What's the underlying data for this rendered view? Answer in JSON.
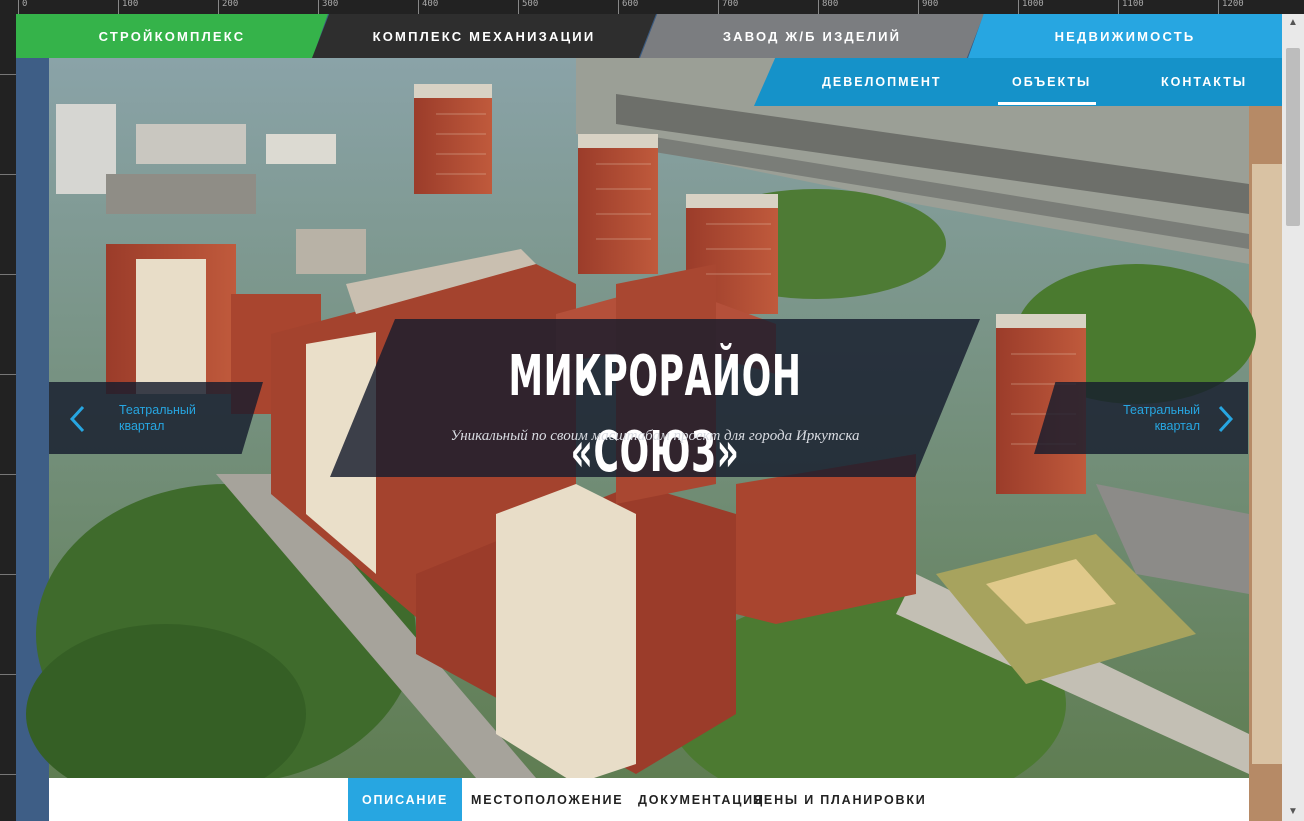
{
  "top_nav": [
    {
      "label": "СТРОЙКОМПЛЕКС",
      "color": "#35b34a"
    },
    {
      "label": "КОМПЛЕКС МЕХАНИЗАЦИИ",
      "color": "#2e2e2e"
    },
    {
      "label": "ЗАВОД Ж/Б ИЗДЕЛИЙ",
      "color": "#7b7d80"
    },
    {
      "label": "НЕДВИЖИМОСТЬ",
      "color": "#27a6e1"
    }
  ],
  "sub_nav": [
    {
      "label": "ДЕВЕЛОПМЕНТ"
    },
    {
      "label": "ОБЪЕКТЫ",
      "active": true
    },
    {
      "label": "КОНТАКТЫ"
    }
  ],
  "hero": {
    "title": "МИКРОРАЙОН «СОЮЗ»",
    "subtitle": "Уникальный по своим масштабам проект для города Иркутска",
    "prev": {
      "label": "Театральный квартал"
    },
    "next": {
      "label": "Театральный квартал"
    }
  },
  "tabs": [
    {
      "label": "ОПИСАНИЕ",
      "active": true
    },
    {
      "label": "МЕСТОПОЛОЖЕНИЕ"
    },
    {
      "label": "ДОКУМЕНТАЦИЯ"
    },
    {
      "label": "ЦЕНЫ И ПЛАНИРОВКИ"
    }
  ],
  "ruler_labels": [
    "0",
    "100",
    "200",
    "300",
    "400",
    "500",
    "600",
    "700",
    "800",
    "900",
    "1000",
    "1100",
    "1200"
  ],
  "icons": {
    "prev": "chevron-left-icon",
    "next": "chevron-right-icon"
  },
  "colors": {
    "accent": "#27a6e1",
    "green": "#35b34a",
    "dark": "#2e2e2e",
    "gray": "#7b7d80"
  }
}
